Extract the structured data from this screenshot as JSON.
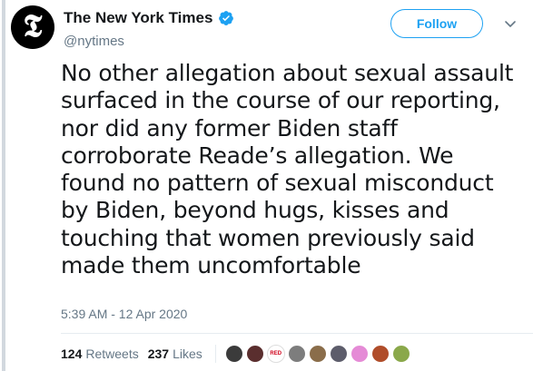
{
  "account": {
    "display_name": "The New York Times",
    "handle": "@nytimes",
    "avatar_letter": "𝕿",
    "verified": true
  },
  "follow_button": {
    "label": "Follow"
  },
  "tweet": {
    "lines": [
      "No other allegation about sexual assault",
      "surfaced in the course of our reporting,",
      "nor did any former Biden staff",
      "corroborate Reade’s allegation. We",
      "found no pattern of sexual misconduct",
      "by Biden, beyond hugs, kisses and",
      "touching that women previously said",
      "made them uncomfortable"
    ],
    "timestamp": "5:39 AM - 12 Apr 2020"
  },
  "stats": {
    "retweets_count": "124",
    "retweets_label": "Retweets",
    "likes_count": "237",
    "likes_label": "Likes"
  },
  "likers": [
    {
      "name": "liker-avatar-1",
      "color": "#3b3b3b"
    },
    {
      "name": "liker-avatar-2",
      "color": "#5a2e2e"
    },
    {
      "name": "liker-avatar-3",
      "label": "RED",
      "color": "#ffffff"
    },
    {
      "name": "liker-avatar-4",
      "color": "#7d7d7d"
    },
    {
      "name": "liker-avatar-5",
      "color": "#8a6d4a"
    },
    {
      "name": "liker-avatar-6",
      "color": "#5d5d6b"
    },
    {
      "name": "liker-avatar-7",
      "color": "#e58bd6"
    },
    {
      "name": "liker-avatar-8",
      "color": "#b04d2a"
    },
    {
      "name": "liker-avatar-9",
      "color": "#8aa84a"
    }
  ],
  "colors": {
    "accent": "#1da1f2",
    "text": "#14171a",
    "secondary": "#657786"
  }
}
